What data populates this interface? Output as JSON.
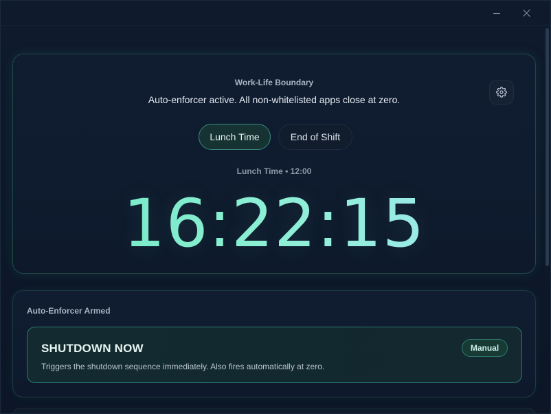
{
  "window": {
    "minimize_icon": "minimize-icon",
    "close_icon": "close-icon"
  },
  "timer": {
    "title": "Work-Life Boundary",
    "subtitle": "Auto-enforcer active. All non-whitelisted apps close at zero.",
    "settings_icon": "gear-icon",
    "modes": [
      {
        "label": "Lunch Time",
        "active": true
      },
      {
        "label": "End of Shift",
        "active": false
      }
    ],
    "target_label": "Lunch Time • 12:00",
    "countdown": "16:22:15"
  },
  "enforcer": {
    "heading": "Auto-Enforcer Armed",
    "shutdown_title": "SHUTDOWN NOW",
    "shutdown_description": "Triggers the shutdown sequence immediately. Also fires automatically at zero.",
    "badge": "Manual"
  },
  "colors": {
    "accent": "#6ee8c0",
    "accent_border": "#3a8a7e",
    "background": "#0c1424",
    "card": "#101c30"
  }
}
